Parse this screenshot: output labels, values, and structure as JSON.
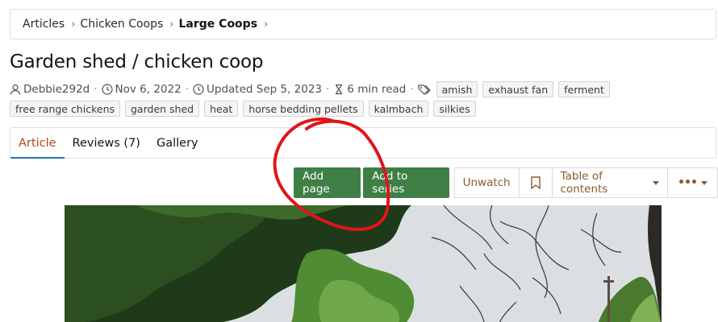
{
  "breadcrumb": {
    "items": [
      {
        "label": "Articles"
      },
      {
        "label": "Chicken Coops"
      },
      {
        "label": "Large Coops"
      }
    ]
  },
  "article": {
    "title": "Garden shed / chicken coop",
    "author": "Debbie292d",
    "date": "Nov 6, 2022",
    "updated": "Updated Sep 5, 2023",
    "read_time": "6 min read"
  },
  "tags": [
    "amish",
    "exhaust fan",
    "ferment",
    "free range chickens",
    "garden shed",
    "heat",
    "horse bedding pellets",
    "kalmbach",
    "silkies"
  ],
  "tabs": [
    {
      "label": "Article",
      "active": true
    },
    {
      "label": "Reviews (7)",
      "active": false
    },
    {
      "label": "Gallery",
      "active": false
    }
  ],
  "actions": {
    "add_page": "Add page",
    "add_to_series": "Add to series",
    "unwatch": "Unwatch",
    "table_of_contents": "Table of contents"
  },
  "colors": {
    "accent_green": "#3f7f45",
    "active_tab": "#b4451e",
    "tab_underline": "#2577b1",
    "annotation_red": "#e0151c"
  }
}
